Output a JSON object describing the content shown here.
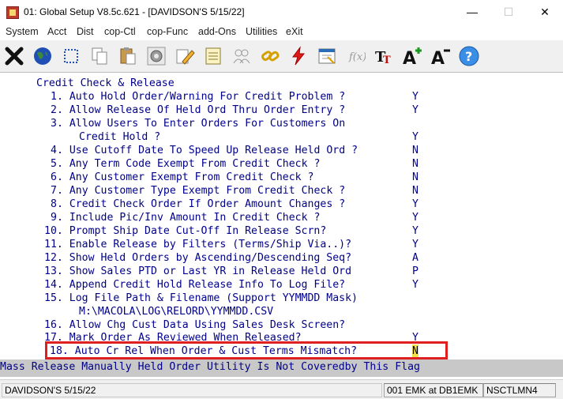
{
  "window": {
    "title": "01: Global Setup V8.5c.621 - [DAVIDSON'S 5/15/22]",
    "minimize": "—",
    "maximize": "☐",
    "close": "✕"
  },
  "menu": [
    {
      "label": "System"
    },
    {
      "label": "Acct"
    },
    {
      "label": "Dist"
    },
    {
      "label": "cop-Ctl"
    },
    {
      "label": "cop-Func"
    },
    {
      "label": "add-Ons"
    },
    {
      "label": "Utilities"
    },
    {
      "label": "eXit"
    }
  ],
  "toolbar": {
    "icons": [
      "close-x-icon",
      "globe-icon",
      "select-box-icon",
      "copy-icon",
      "paste-icon",
      "gear-icon",
      "edit-pencil-icon",
      "notepad-icon",
      "users-icon",
      "link-chain-icon",
      "lightning-icon",
      "calendar-icon",
      "function-icon",
      "text-format-icon",
      "font-increase-icon",
      "font-decrease-icon",
      "help-icon"
    ]
  },
  "screen": {
    "heading": "Credit Check & Release",
    "items": [
      {
        "num": "1.",
        "text": "Auto Hold Order/Warning For Credit Problem ?",
        "value": "Y"
      },
      {
        "num": "2.",
        "text": "Allow Release Of Held Ord Thru Order Entry ?",
        "value": "Y"
      },
      {
        "num": "3.",
        "text": "Allow Users To Enter Orders For Customers On",
        "text2": "Credit Hold ?",
        "value": "Y"
      },
      {
        "num": "4.",
        "text": "Use Cutoff Date To Speed Up Release Held Ord ?",
        "value": "N"
      },
      {
        "num": "5.",
        "text": "Any Term Code Exempt From Credit Check ?",
        "value": "N"
      },
      {
        "num": "6.",
        "text": "Any Customer Exempt From Credit Check ?",
        "value": "N"
      },
      {
        "num": "7.",
        "text": "Any Customer Type Exempt From Credit Check ?",
        "value": "N"
      },
      {
        "num": "8.",
        "text": "Credit Check Order If Order Amount Changes ?",
        "value": "Y"
      },
      {
        "num": "9.",
        "text": "Include Pic/Inv Amount In Credit Check ?",
        "value": "Y"
      },
      {
        "num": "10.",
        "text": "Prompt Ship Date Cut-Off In Release Scrn?",
        "value": "Y"
      },
      {
        "num": "11.",
        "text": "Enable Release by Filters (Terms/Ship Via..)?",
        "value": "Y"
      },
      {
        "num": "12.",
        "text": "Show Held Orders by Ascending/Descending Seq?",
        "value": "A"
      },
      {
        "num": "13.",
        "text": "Show Sales PTD or Last YR in Release Held Ord",
        "value": "P"
      },
      {
        "num": "14.",
        "text": "Append Credit Hold Release Info To Log File?",
        "value": "Y"
      },
      {
        "num": "15.",
        "text": "Log File Path & Filename (Support YYMMDD Mask)",
        "text2": "M:\\MACOLA\\LOG\\RELORD\\YYMMDD.CSV",
        "value": ""
      },
      {
        "num": "16.",
        "text": "Allow Chg Cust Data Using Sales Desk Screen?",
        "value": ""
      },
      {
        "num": "17.",
        "text": "Mark Order As Reviewed When Released?",
        "value": "Y"
      },
      {
        "num": "18.",
        "text": "Auto Cr Rel When Order & Cust Terms Mismatch?",
        "value": "N"
      }
    ],
    "message": "Mass Release Manually Held Order Utility Is Not Coveredby This Flag"
  },
  "status": {
    "company": "DAVIDSON'S 5/15/22",
    "user": "001 EMK at DB1EMK",
    "machine": "NSCTLMN4"
  }
}
